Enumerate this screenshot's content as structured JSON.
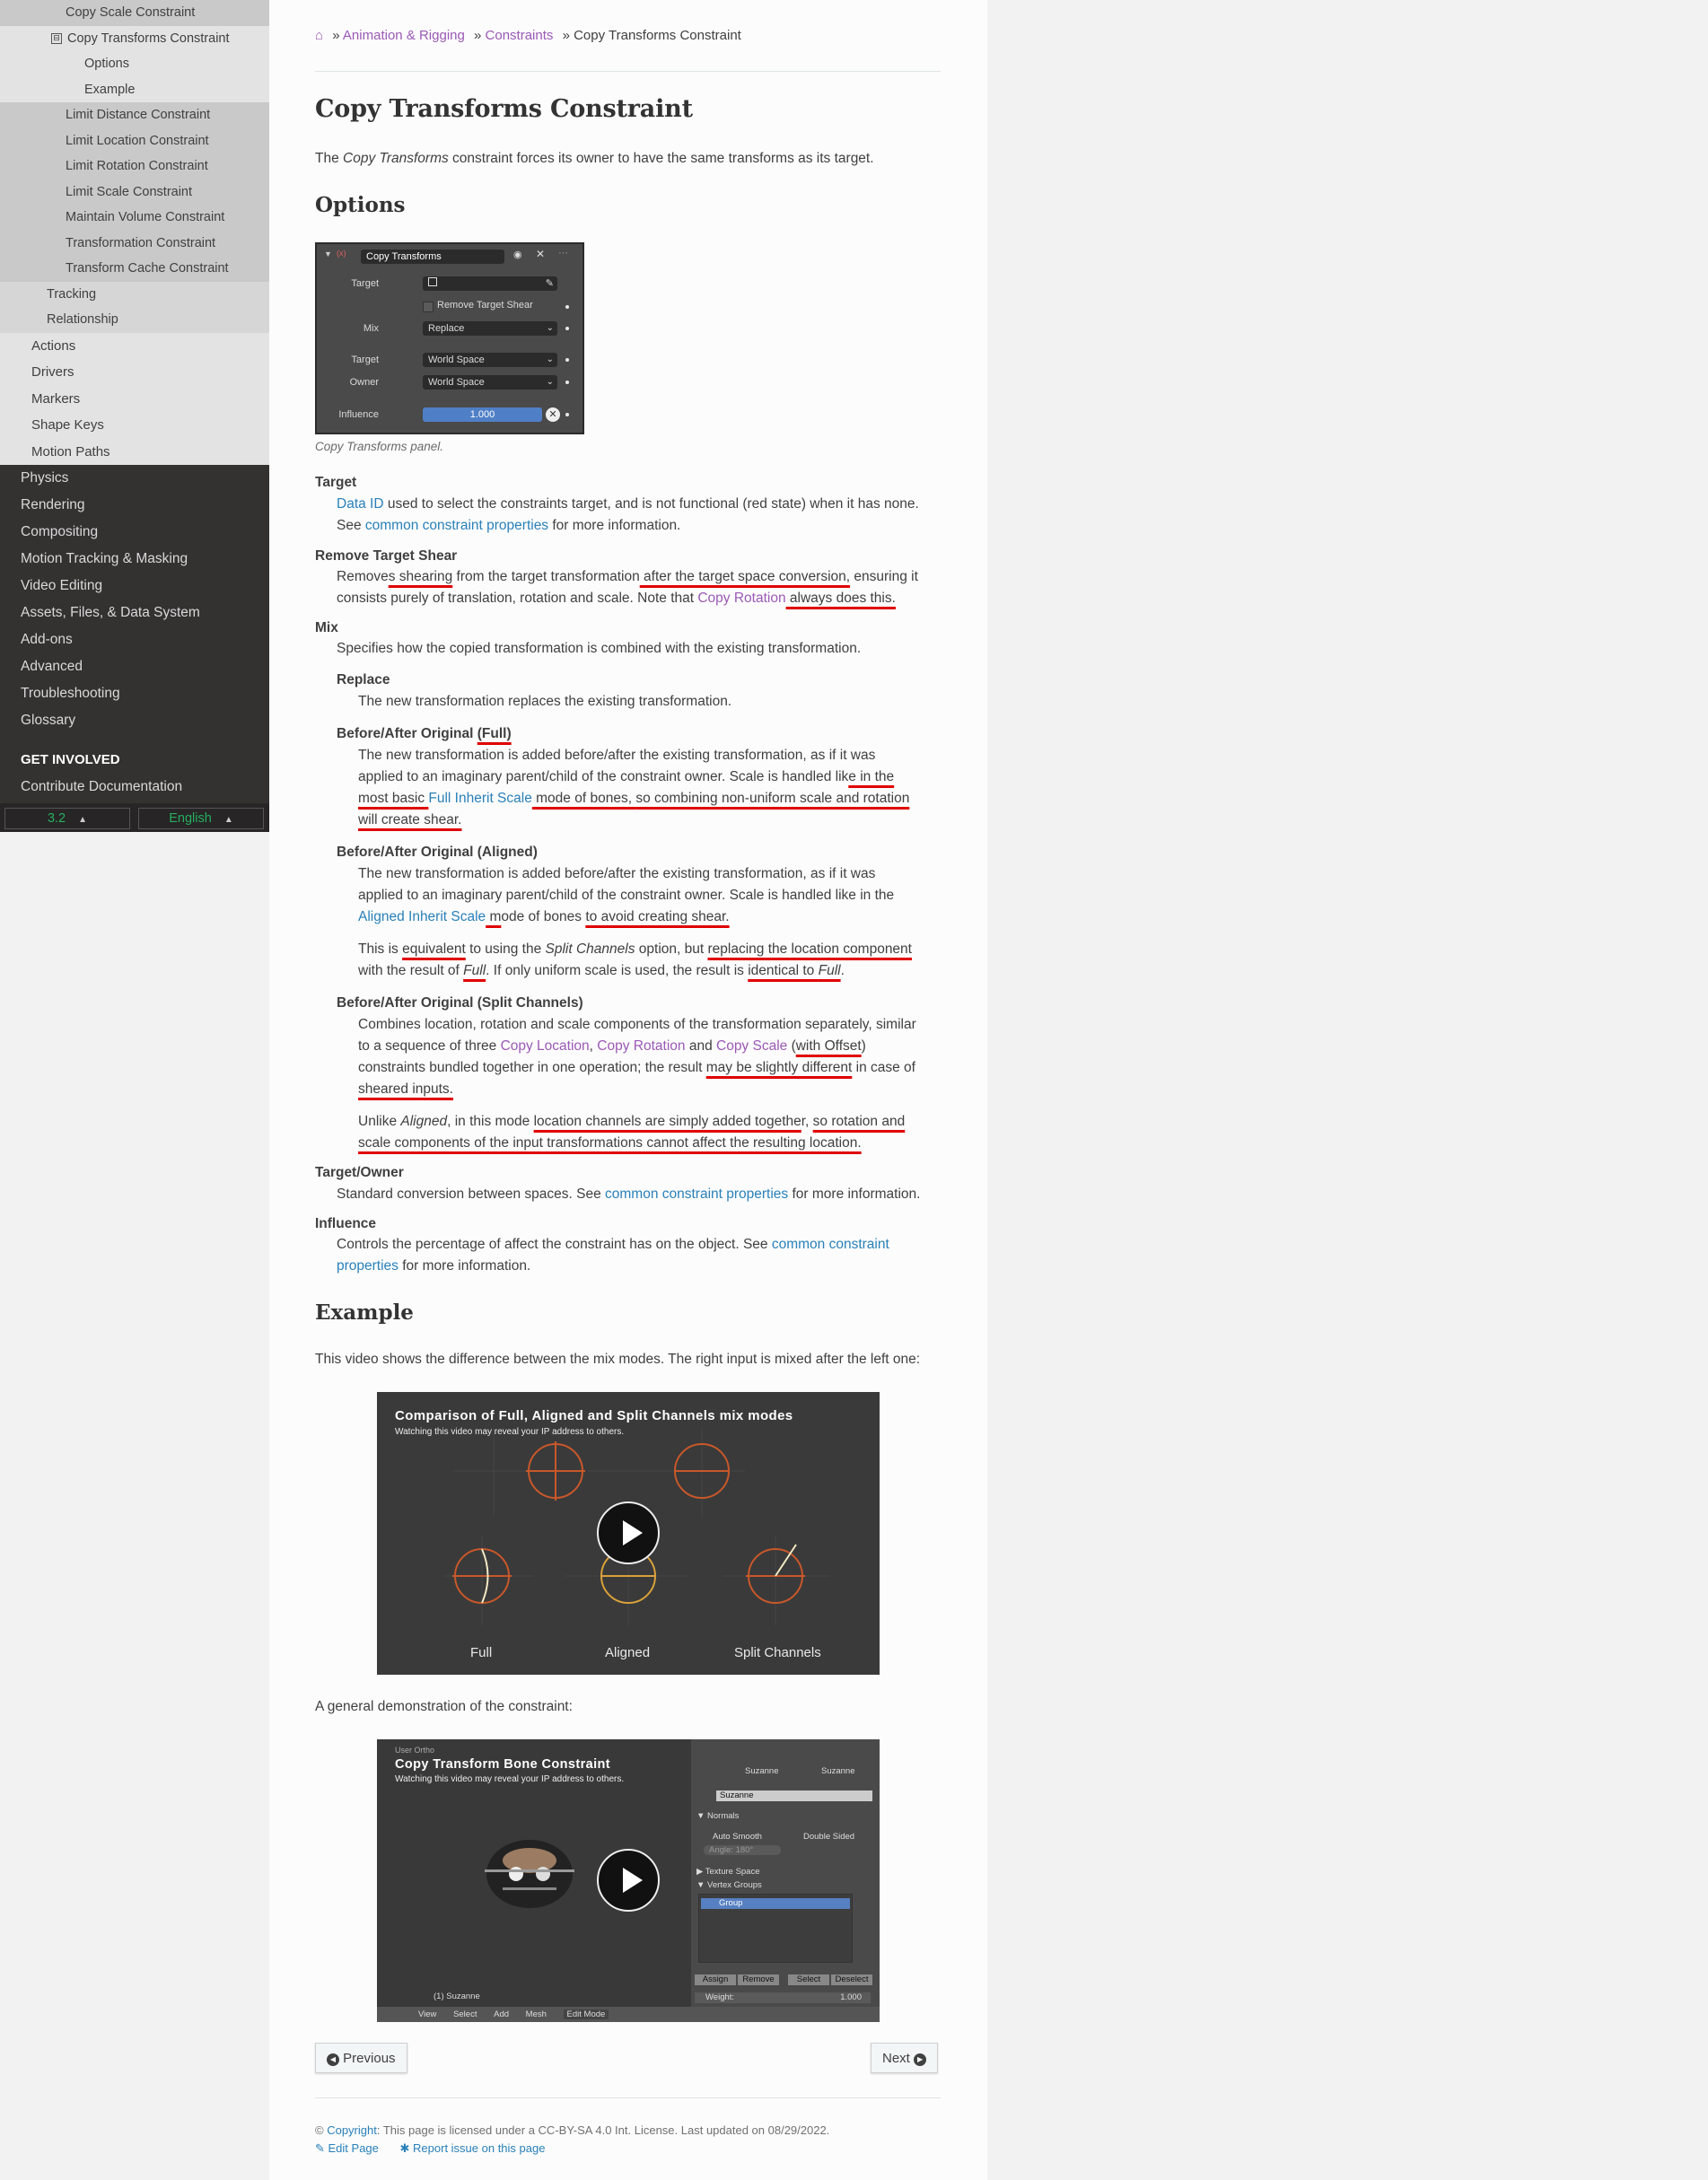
{
  "sidebar": {
    "items": [
      {
        "label": "Copy Scale Constraint",
        "level": 4
      },
      {
        "label": "Copy Transforms Constraint",
        "level": 4,
        "current": true,
        "toggle": "⊟"
      },
      {
        "label": "Options",
        "level": 5
      },
      {
        "label": "Example",
        "level": 5
      },
      {
        "label": "Limit Distance Constraint",
        "level": 4
      },
      {
        "label": "Limit Location Constraint",
        "level": 4
      },
      {
        "label": "Limit Rotation Constraint",
        "level": 4
      },
      {
        "label": "Limit Scale Constraint",
        "level": 4
      },
      {
        "label": "Maintain Volume Constraint",
        "level": 4
      },
      {
        "label": "Transformation Constraint",
        "level": 4
      },
      {
        "label": "Transform Cache Constraint",
        "level": 4
      },
      {
        "label": "Tracking",
        "level": 3
      },
      {
        "label": "Relationship",
        "level": 3
      },
      {
        "label": "Actions",
        "level": 2
      },
      {
        "label": "Drivers",
        "level": 2
      },
      {
        "label": "Markers",
        "level": 2
      },
      {
        "label": "Shape Keys",
        "level": 2
      },
      {
        "label": "Motion Paths",
        "level": 2
      },
      {
        "label": "Physics",
        "level": 1
      },
      {
        "label": "Rendering",
        "level": 1
      },
      {
        "label": "Compositing",
        "level": 1
      },
      {
        "label": "Motion Tracking & Masking",
        "level": 1
      },
      {
        "label": "Video Editing",
        "level": 1
      },
      {
        "label": "Assets, Files, & Data System",
        "level": 1
      },
      {
        "label": "Add-ons",
        "level": 1
      },
      {
        "label": "Advanced",
        "level": 1
      },
      {
        "label": "Troubleshooting",
        "level": 1
      },
      {
        "label": "Glossary",
        "level": 1
      }
    ],
    "get_involved": "GET INVOLVED",
    "contribute": "Contribute Documentation",
    "version": "3.2",
    "language": "English",
    "caret": "▲"
  },
  "breadcrumb": {
    "home_icon": "⌂",
    "sep": "»",
    "crumb1": "Animation & Rigging",
    "crumb2": "Constraints",
    "current": "Copy Transforms Constraint"
  },
  "title": "Copy Transforms Constraint",
  "intro": {
    "pre": "The ",
    "em": "Copy Transforms",
    "post": " constraint forces its owner to have the same transforms as its target."
  },
  "options_heading": "Options",
  "panel": {
    "name": "Copy Transforms",
    "target_label": "Target",
    "remove_shear_label": "Remove Target Shear",
    "mix_label": "Mix",
    "mix_value": "Replace",
    "target_space_label": "Target",
    "target_space_value": "World Space",
    "owner_space_label": "Owner",
    "owner_space_value": "World Space",
    "influence_label": "Influence",
    "influence_value": "1.000"
  },
  "panel_caption": "Copy Transforms panel.",
  "defs": {
    "target": {
      "term": "Target",
      "link1": "Data ID",
      "text1": " used to select the constraints target, and is not functional (red state) when it has none.",
      "text2": "See ",
      "link2": "common constraint properties",
      "text3": " for more information."
    },
    "remove_shear": {
      "term": "Remove Target Shear",
      "a": "Remove",
      "b": "s shearing",
      "c": " from the target transformation",
      "d": " after the target space conversion,",
      "e": " ensuring it",
      "f": "consists purely of translation, rotation and scale. Note that ",
      "link": "Copy Rotation",
      "g": " always does this."
    },
    "mix": {
      "term": "Mix",
      "desc": "Specifies how the copied transformation is combined with the existing transformation."
    },
    "replace": {
      "term": "Replace",
      "desc": "The new transformation replaces the existing transformation."
    },
    "full": {
      "term_a": "Before/After Original ",
      "term_b": "(Full)",
      "l1": "The new transformation is added before/after the existing transformation, as if it was",
      "l2a": "applied to an imaginary parent/child of the constraint owner. Scale is handled lik",
      "l2b": "e in the",
      "l3a": "most basic ",
      "l3link": "Full Inherit Scale",
      "l3b": " mode of bones, ",
      "l3c": "so combining non-uniform scale and rotation",
      "l4": "will create shear."
    },
    "aligned": {
      "term": "Before/After Original (Aligned)",
      "l1": "The new transformation is added before/after the existing transformation, as if it was",
      "l2": "applied to an imaginary parent/child of the constraint owner. Scale is handled like in the",
      "l3link": "Aligned Inherit Scale",
      "l3a": " m",
      "l3b": "ode of bones ",
      "l3c": "to avoid creating shear.",
      "p2a": "This is ",
      "p2b": "equivalent",
      "p2c": " to using the ",
      "p2em": "Split Channels",
      "p2d": " option, but ",
      "p2e": "replacing the location component",
      "p2f": "with the result of ",
      "p2em2": "Full",
      "p2g": ". If only uniform scale is used, the result is ",
      "p2h": "identical to ",
      "p2em3": "Full",
      "p2i": "."
    },
    "split": {
      "term": "Before/After Original (Split Channels)",
      "l1": "Combines location, rotation and scale components of the transformation separately, similar",
      "l2a": "to a sequence of three ",
      "link1": "Copy Location",
      "comma": ", ",
      "link2": "Copy Rotation",
      "and": " and ",
      "link3": "Copy Scale",
      "l2b": " (",
      "l2c": "with Offset",
      "l2d": ")",
      "l3a": "constraints bundled together in one operation; the result ",
      "l3b": "may be slightly different",
      "l3c": " in case of",
      "l4": "sheared inputs.",
      "p2a": "Unlike ",
      "p2em": "Aligned",
      "p2b": ", in this mode ",
      "p2c": "location channels are simply added togethe",
      "p2d": "r, ",
      "p2e": "so rotation and",
      "p2f": "scale components of the input transformations cannot affect the resulting location."
    },
    "target_owner": {
      "term": "Target/Owner",
      "a": "Standard conversion between spaces. See ",
      "link": "common constraint properties",
      "b": " for more information."
    },
    "influence": {
      "term": "Influence",
      "a": "Controls the percentage of affect the constraint has on the object. See ",
      "link1": "common constraint",
      "link2": "properties",
      "b": " for more information."
    }
  },
  "example_heading": "Example",
  "example_text": "This video shows the difference between the mix modes. The right input is mixed after the left one:",
  "video1": {
    "title": "Comparison of Full, Aligned and Split Channels mix modes",
    "sub": "Watching this video may reveal your IP address to others.",
    "labels": [
      "Full",
      "Aligned",
      "Split Channels"
    ]
  },
  "general_text": "A general demonstration of the constraint:",
  "video2": {
    "title": "Copy Transform Bone Constraint",
    "sub": "Watching this video may reveal your IP address to others.",
    "topleft": "User Ortho",
    "obj": "(1) Suzanne",
    "name_field": "Suzanne",
    "tab1": "Suzanne",
    "tab2": "Suzanne",
    "normals": "▼ Normals",
    "auto_smooth": "Auto Smooth",
    "double_sided": "Double Sided",
    "angle": "Angle:   180°",
    "texture_space": "▶ Texture Space",
    "vertex_groups": "▼ Vertex Groups",
    "group": "Group",
    "assign": "Assign",
    "remove": "Remove",
    "select": "Select",
    "deselect": "Deselect",
    "weight": "Weight:",
    "weight_val": "1.000",
    "menu": [
      "View",
      "Select",
      "Add",
      "Mesh"
    ],
    "mode": "Edit Mode"
  },
  "nav": {
    "previous": "Previous",
    "next": "Next",
    "prev_icon": "◀",
    "next_icon": "▶"
  },
  "footer": {
    "copy": "© ",
    "copyright": "Copyright",
    "text": ": This page is licensed under a CC-BY-SA 4.0 Int. License. Last updated on 08/29/2022.",
    "edit": "Edit Page",
    "report": "Report issue on this page"
  },
  "colors": {
    "link": "#2980b9",
    "visited": "#9b59b6",
    "sidebar_bg": "#343131",
    "underline": "#e00000",
    "green": "#27ae60"
  }
}
